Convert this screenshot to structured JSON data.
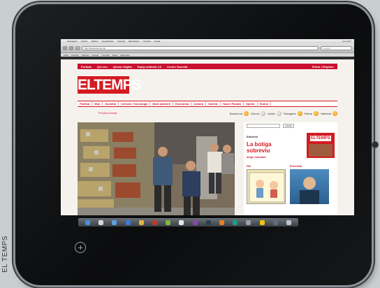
{
  "credit": "EL TEMPS",
  "browser": {
    "menu_items": [
      "Navegador",
      "Archivo",
      "Edición",
      "Visualización",
      "Historial",
      "Marcadores",
      "Ventana",
      "Ayuda"
    ],
    "clock": "jue 13:37",
    "url": "http://www.eltemps.cat",
    "search_placeholder": "Google",
    "bookmarks": [
      "Llista",
      "Favorits",
      "Notícies",
      "Google",
      "YouTube",
      "Maps",
      "Wikipedia"
    ]
  },
  "site": {
    "topnav": [
      "Portada",
      "Qui sou",
      "Quiosc Digital",
      "Equip editorial 3.0",
      "Centre Societat"
    ],
    "login": "Entrar | Registre",
    "logo": "ELTEMPS",
    "sections": [
      "Política",
      "Món",
      "Societat",
      "Ciència i Tecnologia",
      "Medi ambient",
      "Economia",
      "Cultura",
      "Galeria",
      "Tauler Parada",
      "Opinió",
      "Humor"
    ],
    "meteo_label": "Previsió el temps",
    "cities": [
      {
        "name": "Barcelona",
        "icon": "sun-icon"
      },
      {
        "name": "Girona",
        "icon": "cloud-icon"
      },
      {
        "name": "Lleida",
        "icon": "cloud-icon"
      },
      {
        "name": "Tarragona",
        "icon": "sun-icon"
      },
      {
        "name": "Palma",
        "icon": "sun-icon"
      },
      {
        "name": "València",
        "icon": "sun-icon"
      }
    ],
    "sidebar": {
      "search_button": "Cerca",
      "editorial_label": "Editorial",
      "editorial_title": "La botiga sobreviu",
      "editorial_link": "Alegir comentari",
      "thumb_logo": "ELTEMPS",
      "pin_label": "PIN",
      "ent_label": "Entrevista"
    }
  },
  "colors": {
    "brand_red": "#d51a21",
    "tablet_bezel": "#111214"
  }
}
